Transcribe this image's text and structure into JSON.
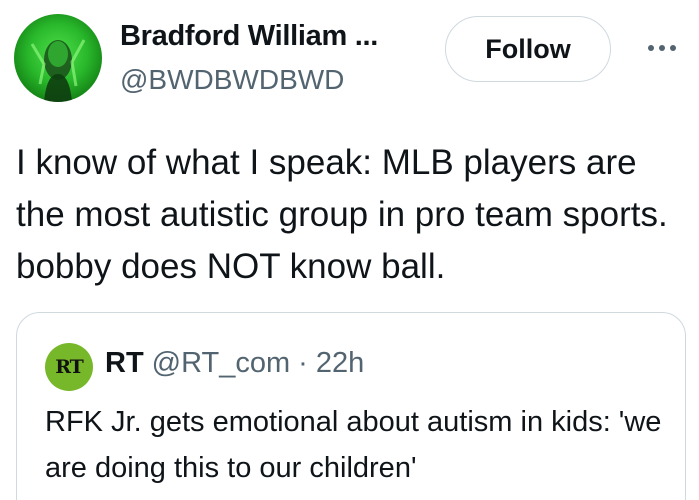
{
  "author": {
    "display_name": "Bradford William ...",
    "handle": "@BWDBWDBWD",
    "avatar_icon": "profile-photo-green"
  },
  "actions": {
    "follow_label": "Follow",
    "more_icon": "more-horizontal-icon"
  },
  "tweet": {
    "text": "I know of what I speak: MLB players are the most autistic group in pro team sports. bobby does NOT know ball."
  },
  "quoted_tweet": {
    "avatar_label": "RT",
    "name": "RT",
    "handle": "@RT_com",
    "separator": "·",
    "time": "22h",
    "text": "RFK Jr. gets emotional about autism in kids: 'we are doing this to our children'"
  },
  "colors": {
    "text_primary": "#0f1419",
    "text_secondary": "#536471",
    "border": "#cfd9de",
    "rt_logo_bg": "#77b82a"
  }
}
